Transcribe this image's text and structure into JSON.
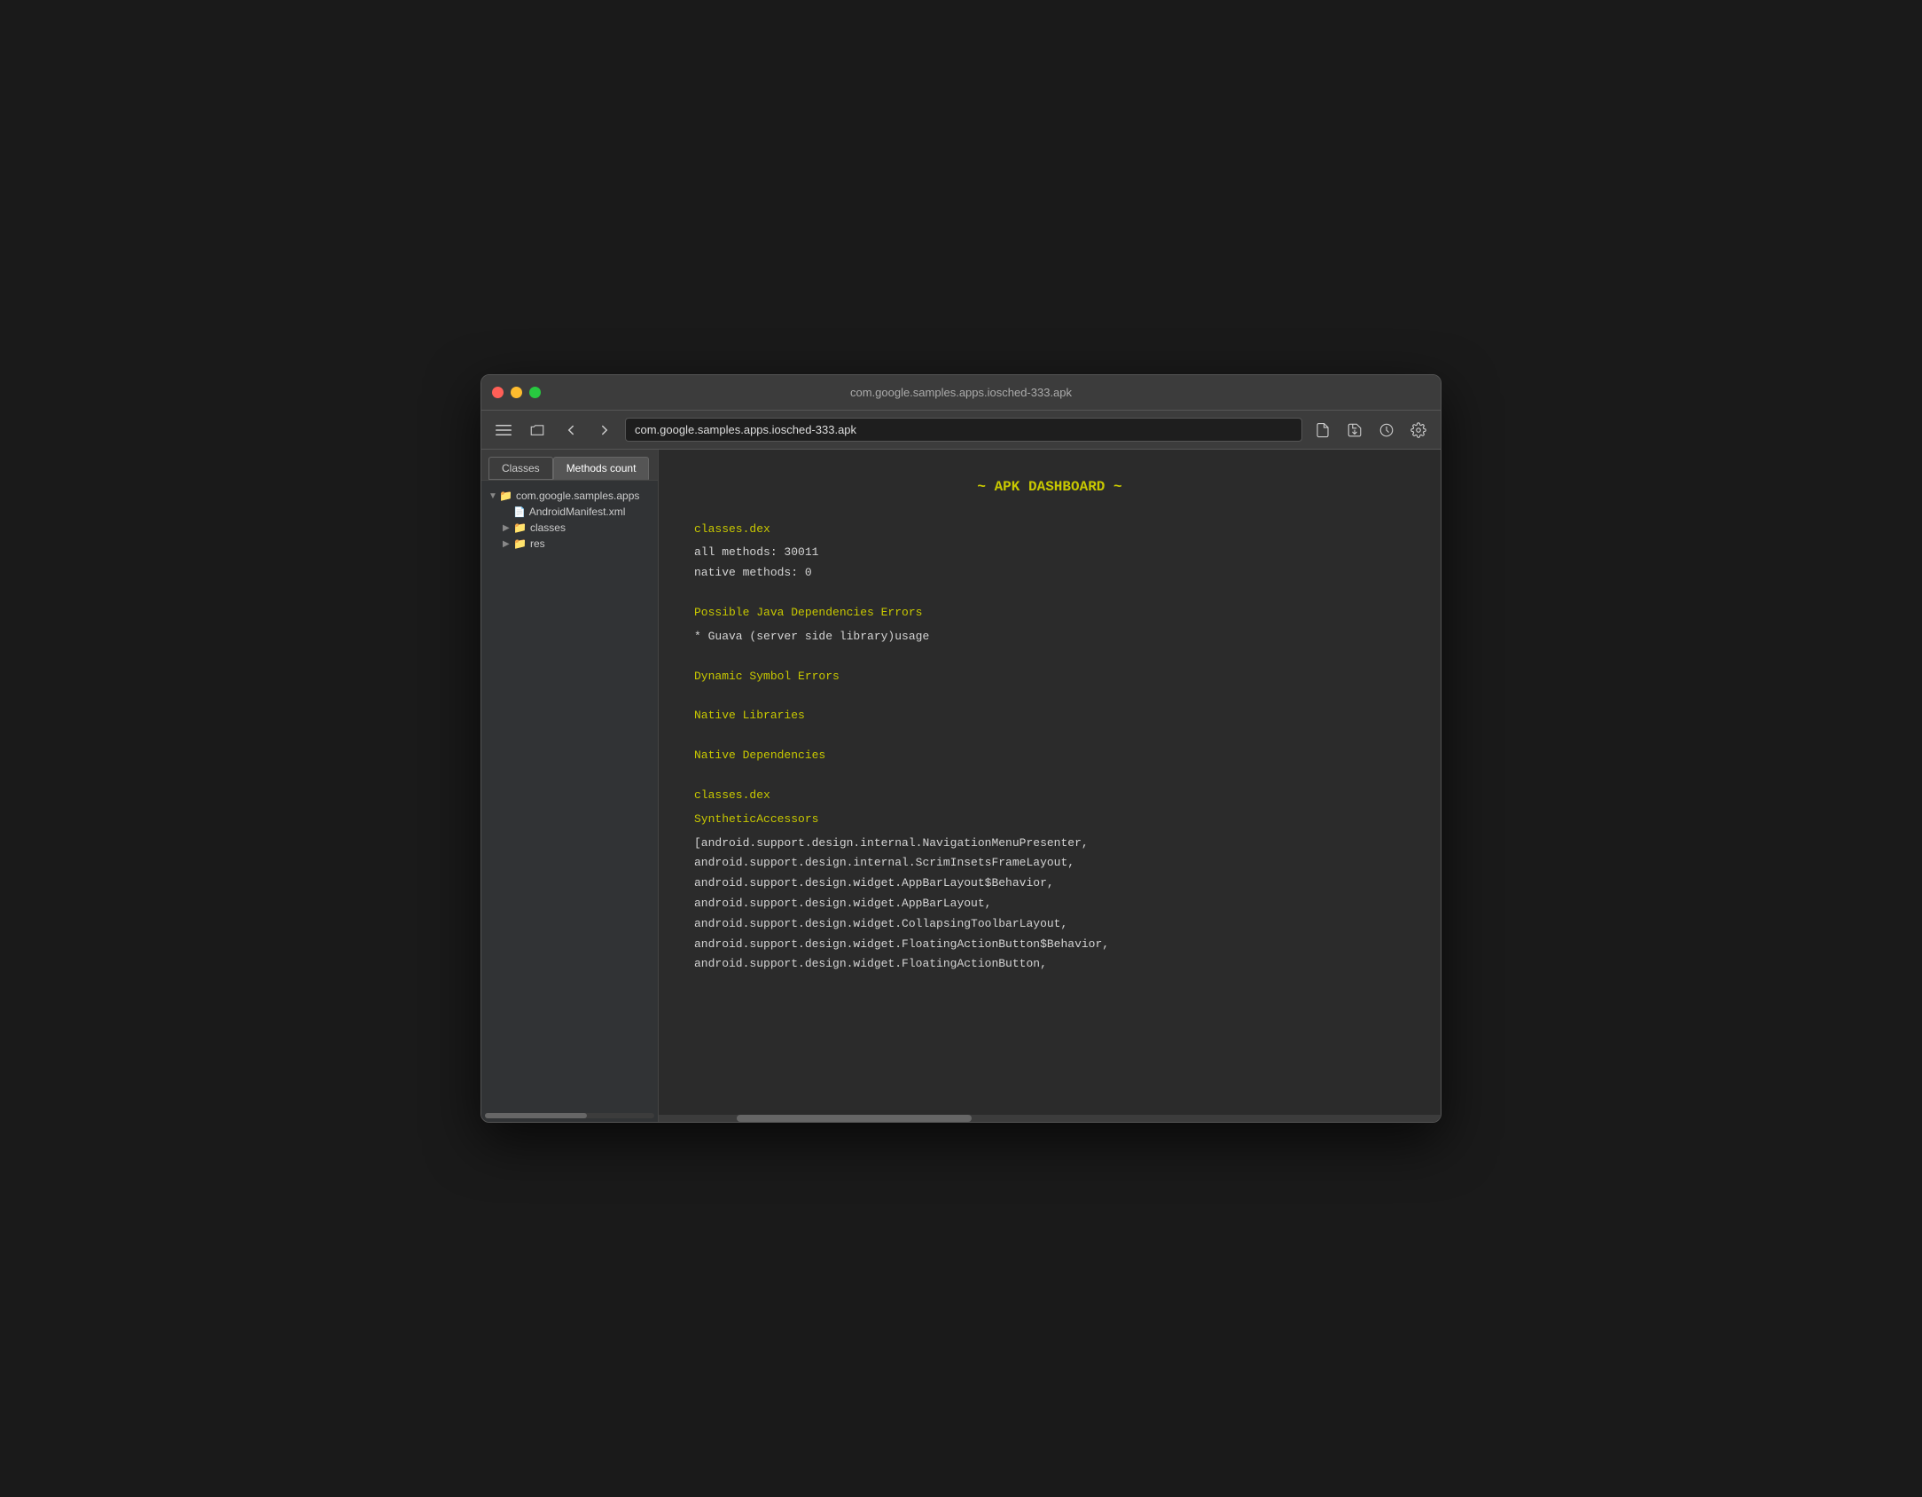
{
  "window": {
    "title": "com.google.samples.apps.iosched-333.apk"
  },
  "toolbar": {
    "address": "com.google.samples.apps.iosched-333.apk",
    "menu_icon": "☰",
    "folder_icon": "📁",
    "back_icon": "←",
    "forward_icon": "→",
    "file_icon": "📄",
    "export_icon": "⬆",
    "history_icon": "🕐",
    "settings_icon": "⚙"
  },
  "sidebar": {
    "tabs": [
      {
        "label": "Classes",
        "active": false
      },
      {
        "label": "Methods count",
        "active": true
      }
    ],
    "tree": [
      {
        "level": 0,
        "type": "folder",
        "label": "com.google.samples.apps",
        "expanded": true,
        "selected": false
      },
      {
        "level": 1,
        "type": "file",
        "label": "AndroidManifest.xml",
        "selected": false
      },
      {
        "level": 1,
        "type": "folder",
        "label": "classes",
        "expanded": false,
        "selected": false
      },
      {
        "level": 1,
        "type": "folder",
        "label": "res",
        "expanded": false,
        "selected": false
      }
    ]
  },
  "main": {
    "dashboard_title": "~ APK DASHBOARD ~",
    "sections": [
      {
        "id": "classes-dex-1",
        "header": "classes.dex",
        "content": [
          "all methods: 30011",
          "native methods: 0"
        ]
      },
      {
        "id": "possible-java-deps",
        "header": "Possible Java Dependencies Errors",
        "content": [
          "* Guava (server side library)usage"
        ]
      },
      {
        "id": "dynamic-symbol-errors",
        "header": "Dynamic Symbol Errors",
        "content": []
      },
      {
        "id": "native-libraries",
        "header": "Native Libraries",
        "content": []
      },
      {
        "id": "native-dependencies",
        "header": "Native Dependencies",
        "content": []
      },
      {
        "id": "classes-dex-2",
        "header": "classes.dex",
        "subheader": "SyntheticAccessors",
        "content": [
          "[android.support.design.internal.NavigationMenuPresenter,",
          "android.support.design.internal.ScrimInsetsFrameLayout,",
          "android.support.design.widget.AppBarLayout$Behavior,",
          "android.support.design.widget.AppBarLayout,",
          "android.support.design.widget.CollapsingToolbarLayout,",
          "android.support.design.widget.FloatingActionButton$Behavior,",
          "android.support.design.widget.FloatingActionButton,"
        ]
      }
    ]
  }
}
